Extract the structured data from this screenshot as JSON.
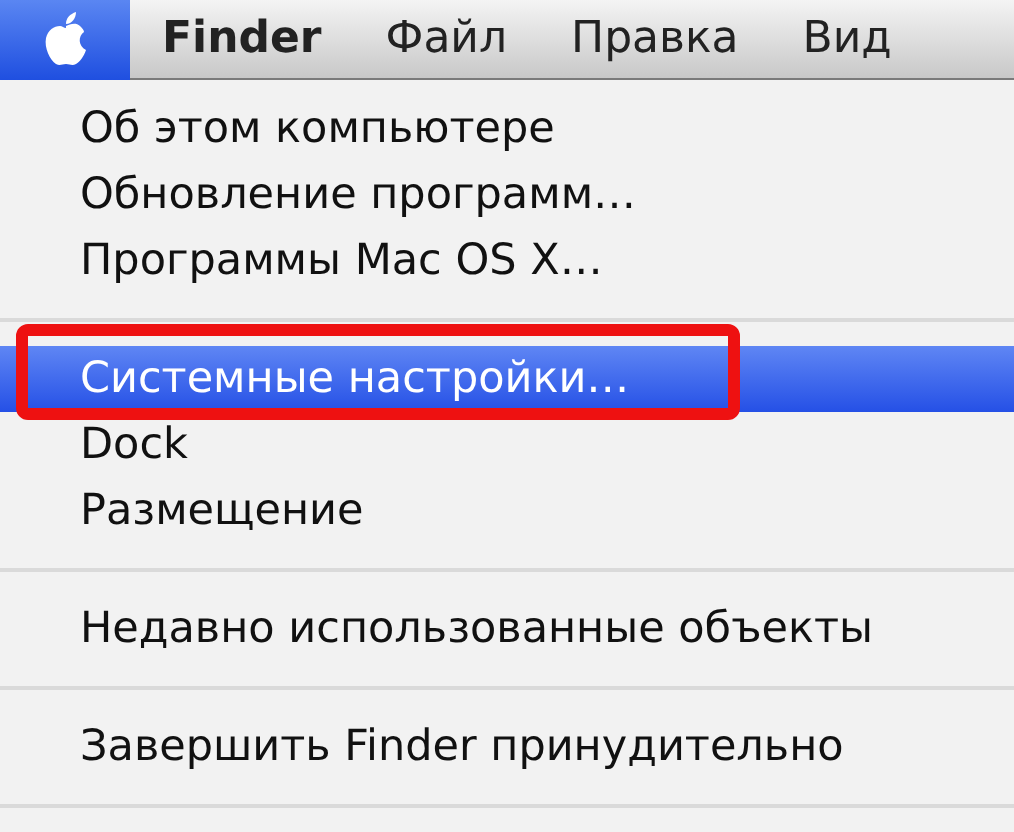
{
  "menu_bar": {
    "items": [
      {
        "kind": "apple",
        "selected": true
      },
      {
        "kind": "text",
        "label": "Finder",
        "bold": true,
        "selected": false
      },
      {
        "kind": "text",
        "label": "Файл",
        "bold": false,
        "selected": false
      },
      {
        "kind": "text",
        "label": "Правка",
        "bold": false,
        "selected": false
      },
      {
        "kind": "text",
        "label": "Вид",
        "bold": false,
        "selected": false
      }
    ]
  },
  "menu": {
    "items": [
      {
        "kind": "item",
        "label": "Об этом компьютере",
        "selected": false,
        "annotated": false
      },
      {
        "kind": "item",
        "label": "Обновление программ…",
        "selected": false,
        "annotated": false
      },
      {
        "kind": "item",
        "label": "Программы Mac OS X…",
        "selected": false,
        "annotated": false
      },
      {
        "kind": "separator"
      },
      {
        "kind": "item",
        "label": "Системные настройки…",
        "selected": true,
        "annotated": true
      },
      {
        "kind": "item",
        "label": "Dock",
        "selected": false,
        "annotated": false
      },
      {
        "kind": "item",
        "label": "Размещение",
        "selected": false,
        "annotated": false
      },
      {
        "kind": "separator"
      },
      {
        "kind": "item",
        "label": "Недавно использованные объекты",
        "selected": false,
        "annotated": false
      },
      {
        "kind": "separator"
      },
      {
        "kind": "item",
        "label": "Завершить Finder принудительно",
        "selected": false,
        "annotated": false
      },
      {
        "kind": "separator"
      }
    ]
  }
}
